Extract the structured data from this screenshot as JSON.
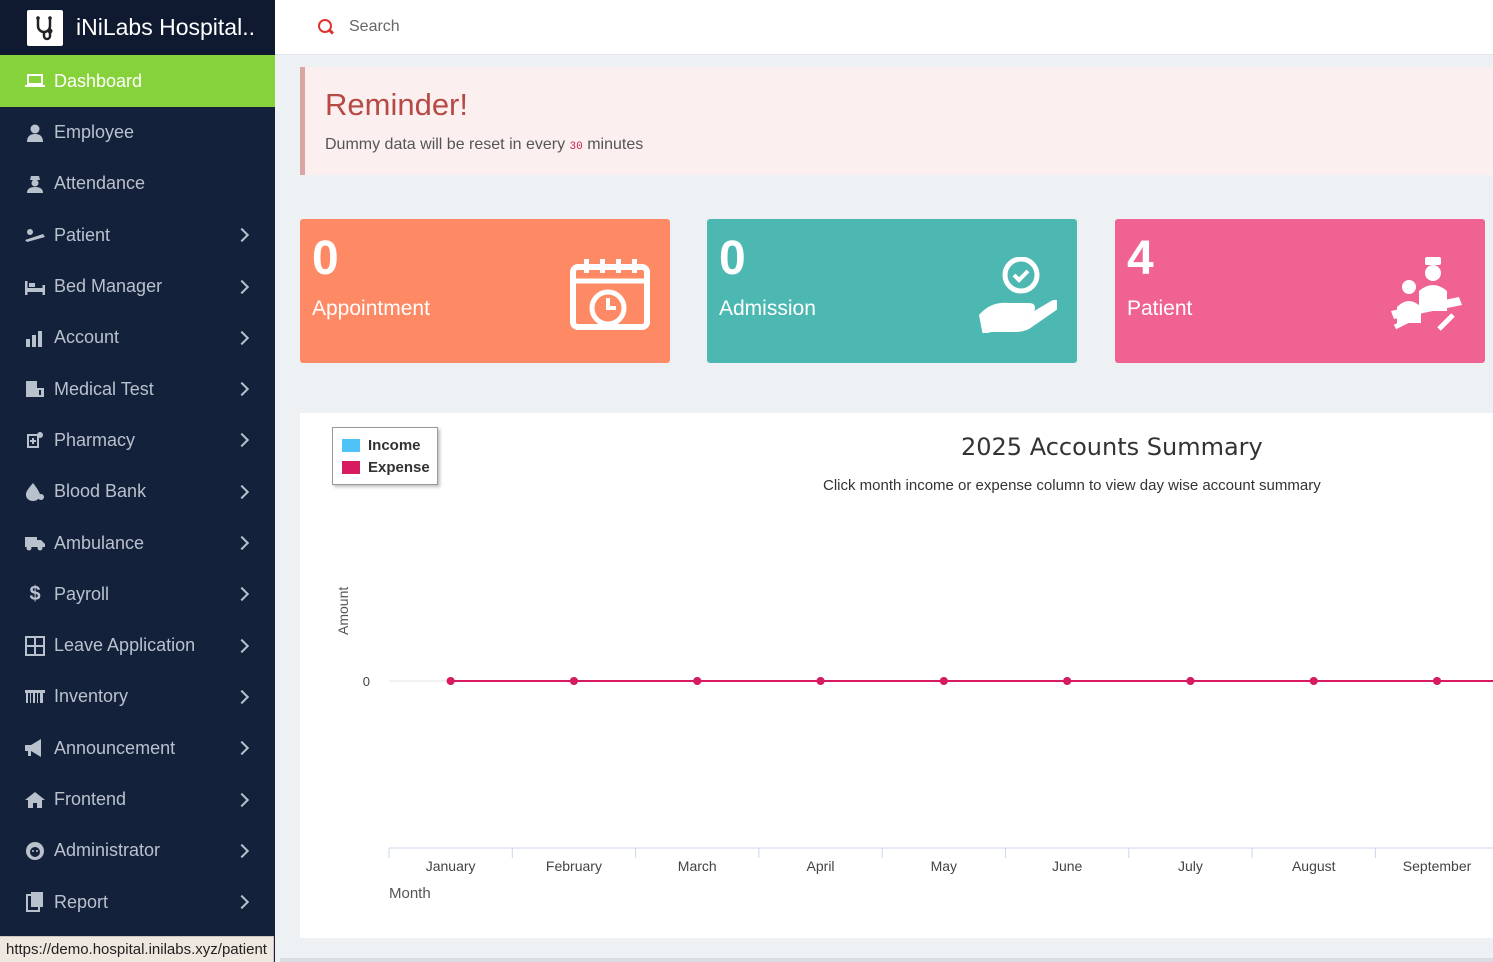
{
  "brand": {
    "title": "iNiLabs Hospital..",
    "logo_icon": "stethoscope-icon"
  },
  "search": {
    "placeholder": "Search"
  },
  "sidebar": {
    "items": [
      {
        "label": "Dashboard",
        "icon": "laptop-icon",
        "active": true,
        "has_children": false
      },
      {
        "label": "Employee",
        "icon": "user-icon",
        "active": false,
        "has_children": false
      },
      {
        "label": "Attendance",
        "icon": "user-secret-icon",
        "active": false,
        "has_children": false
      },
      {
        "label": "Patient",
        "icon": "bed-patient-icon",
        "active": false,
        "has_children": true
      },
      {
        "label": "Bed Manager",
        "icon": "bed-icon",
        "active": false,
        "has_children": true
      },
      {
        "label": "Account",
        "icon": "bar-chart-icon",
        "active": false,
        "has_children": true
      },
      {
        "label": "Medical Test",
        "icon": "medkit-icon",
        "active": false,
        "has_children": true
      },
      {
        "label": "Pharmacy",
        "icon": "pharmacy-icon",
        "active": false,
        "has_children": true
      },
      {
        "label": "Blood Bank",
        "icon": "blood-drop-icon",
        "active": false,
        "has_children": true
      },
      {
        "label": "Ambulance",
        "icon": "ambulance-icon",
        "active": false,
        "has_children": true
      },
      {
        "label": "Payroll",
        "icon": "dollar-icon",
        "active": false,
        "has_children": true
      },
      {
        "label": "Leave Application",
        "icon": "columns-icon",
        "active": false,
        "has_children": true
      },
      {
        "label": "Inventory",
        "icon": "barcode-icon",
        "active": false,
        "has_children": true
      },
      {
        "label": "Announcement",
        "icon": "bullhorn-icon",
        "active": false,
        "has_children": true
      },
      {
        "label": "Frontend",
        "icon": "home-icon",
        "active": false,
        "has_children": true
      },
      {
        "label": "Administrator",
        "icon": "administrator-icon",
        "active": false,
        "has_children": true
      },
      {
        "label": "Report",
        "icon": "report-icon",
        "active": false,
        "has_children": true
      }
    ]
  },
  "reminder": {
    "title": "Reminder!",
    "text_before": "Dummy data will be reset in every",
    "minutes": "30",
    "text_after": "minutes"
  },
  "cards": {
    "appointment": {
      "count": "0",
      "label": "Appointment",
      "icon": "calendar-clock-icon",
      "color": "#fe8a65"
    },
    "admission": {
      "count": "0",
      "label": "Admission",
      "icon": "hand-clock-icon",
      "color": "#4db8b1"
    },
    "patient": {
      "count": "4",
      "label": "Patient",
      "icon": "patient-group-icon",
      "color": "#f06291"
    }
  },
  "chart": {
    "title": "2025 Accounts Summary",
    "subtitle": "Click month income or expense column to view day wise account summary",
    "ylabel": "Amount",
    "xlabel": "Month",
    "legend": [
      {
        "name": "Income",
        "color": "#4fc3f7"
      },
      {
        "name": "Expense",
        "color": "#d81b60"
      }
    ]
  },
  "chart_data": {
    "type": "line",
    "title": "2025 Accounts Summary",
    "xlabel": "Month",
    "ylabel": "Amount",
    "categories": [
      "January",
      "February",
      "March",
      "April",
      "May",
      "June",
      "July",
      "August",
      "September"
    ],
    "y_ticks": [
      "0"
    ],
    "legend_position": "top-left",
    "series": [
      {
        "name": "Income",
        "color": "#4fc3f7",
        "values": [
          0,
          0,
          0,
          0,
          0,
          0,
          0,
          0,
          0
        ]
      },
      {
        "name": "Expense",
        "color": "#d81b60",
        "values": [
          0,
          0,
          0,
          0,
          0,
          0,
          0,
          0,
          0
        ]
      }
    ]
  },
  "statusbar": {
    "url": "https://demo.hospital.inilabs.xyz/patient"
  }
}
